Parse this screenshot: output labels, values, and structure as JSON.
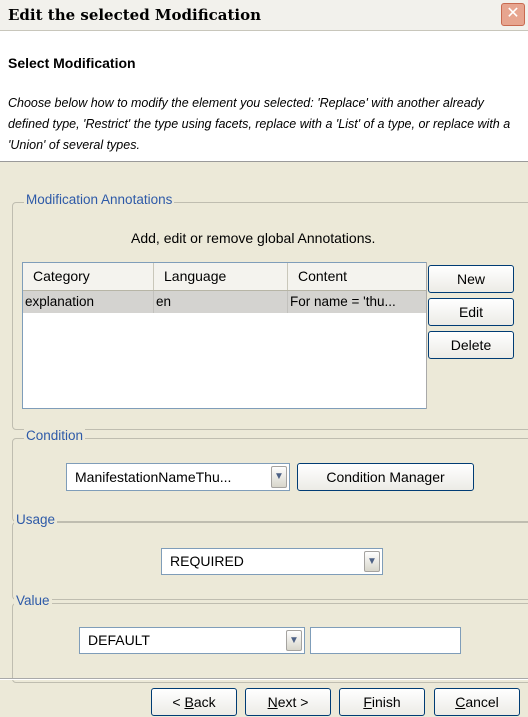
{
  "window": {
    "title": "Edit the selected Modification",
    "close_glyph": "✕"
  },
  "header": {
    "title": "Select Modification",
    "description": "Choose below how to modify the element you selected: 'Replace' with another already defined type, 'Restrict' the type using facets, replace with a 'List' of a type, or replace with a 'Union' of several types."
  },
  "annotations": {
    "group_label": "Modification Annotations",
    "hint": "Add, edit or remove global Annotations.",
    "columns": [
      "Category",
      "Language",
      "Content"
    ],
    "rows": [
      {
        "category": "explanation",
        "language": "en",
        "content": "For name = 'thu..."
      }
    ],
    "buttons": {
      "new": "New",
      "edit": "Edit",
      "delete": "Delete"
    }
  },
  "condition": {
    "group_label": "Condition",
    "selected": "ManifestationNameThu...",
    "manager_button": "Condition Manager"
  },
  "usage": {
    "group_label": "Usage",
    "selected": "REQUIRED"
  },
  "value": {
    "group_label": "Value",
    "selected": "DEFAULT",
    "text": ""
  },
  "footer": {
    "back_prefix": "< ",
    "back_mnemonic": "B",
    "back_rest": "ack",
    "next_mnemonic": "N",
    "next_rest": "ext >",
    "finish_mnemonic": "F",
    "finish_rest": "inish",
    "cancel_mnemonic": "C",
    "cancel_rest": "ancel"
  },
  "icons": {
    "dropdown_arrow": "chevron-down-icon",
    "close": "close-icon"
  },
  "colors": {
    "group_label": "#2e5aa8",
    "dialog_bg": "#ece9d8",
    "selected_row": "#d4d3d0"
  }
}
